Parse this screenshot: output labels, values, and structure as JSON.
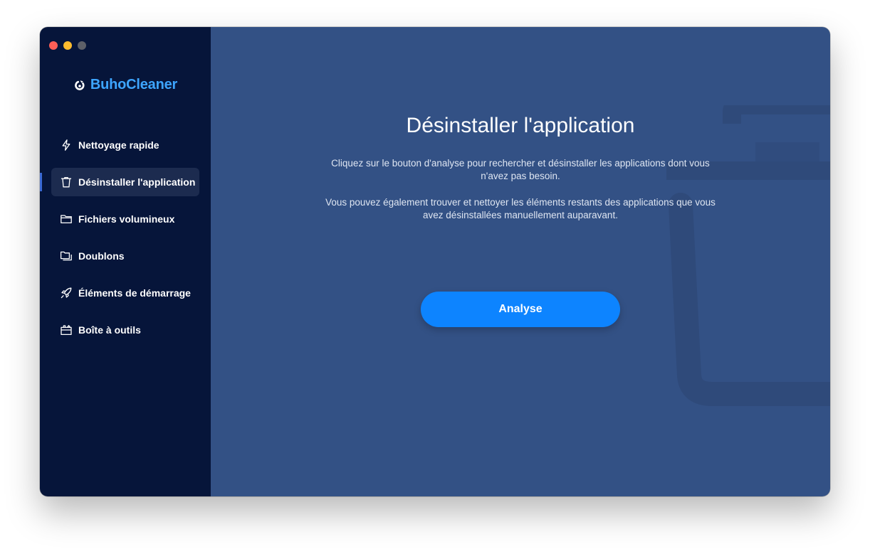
{
  "window": {
    "controls": [
      "close",
      "minimize",
      "zoom"
    ]
  },
  "brand": {
    "name": "BuhoCleaner",
    "logo_icon": "buho-logo-icon",
    "color": "#3da5ff"
  },
  "sidebar": {
    "background": "#06153a",
    "items": [
      {
        "label": "Nettoyage rapide",
        "icon": "lightning-icon",
        "active": false
      },
      {
        "label": "Désinstaller l'application",
        "icon": "trash-icon",
        "active": true
      },
      {
        "label": "Fichiers volumineux",
        "icon": "folder-icon",
        "active": false
      },
      {
        "label": "Doublons",
        "icon": "duplicate-folder-icon",
        "active": false
      },
      {
        "label": "Éléments de démarrage",
        "icon": "rocket-icon",
        "active": false
      },
      {
        "label": "Boîte à outils",
        "icon": "toolbox-icon",
        "active": false
      }
    ]
  },
  "main": {
    "background": "#335185",
    "title": "Désinstaller l'application",
    "description_1": "Cliquez sur le bouton d'analyse pour rechercher et désinstaller les applications dont vous n'avez pas besoin.",
    "description_2": "Vous pouvez également trouver et nettoyer les éléments restants des applications que vous avez désinstallées manuellement auparavant.",
    "analyse_label": "Analyse",
    "accent": "#0d84ff",
    "background_icon": "trash-watermark-icon"
  }
}
